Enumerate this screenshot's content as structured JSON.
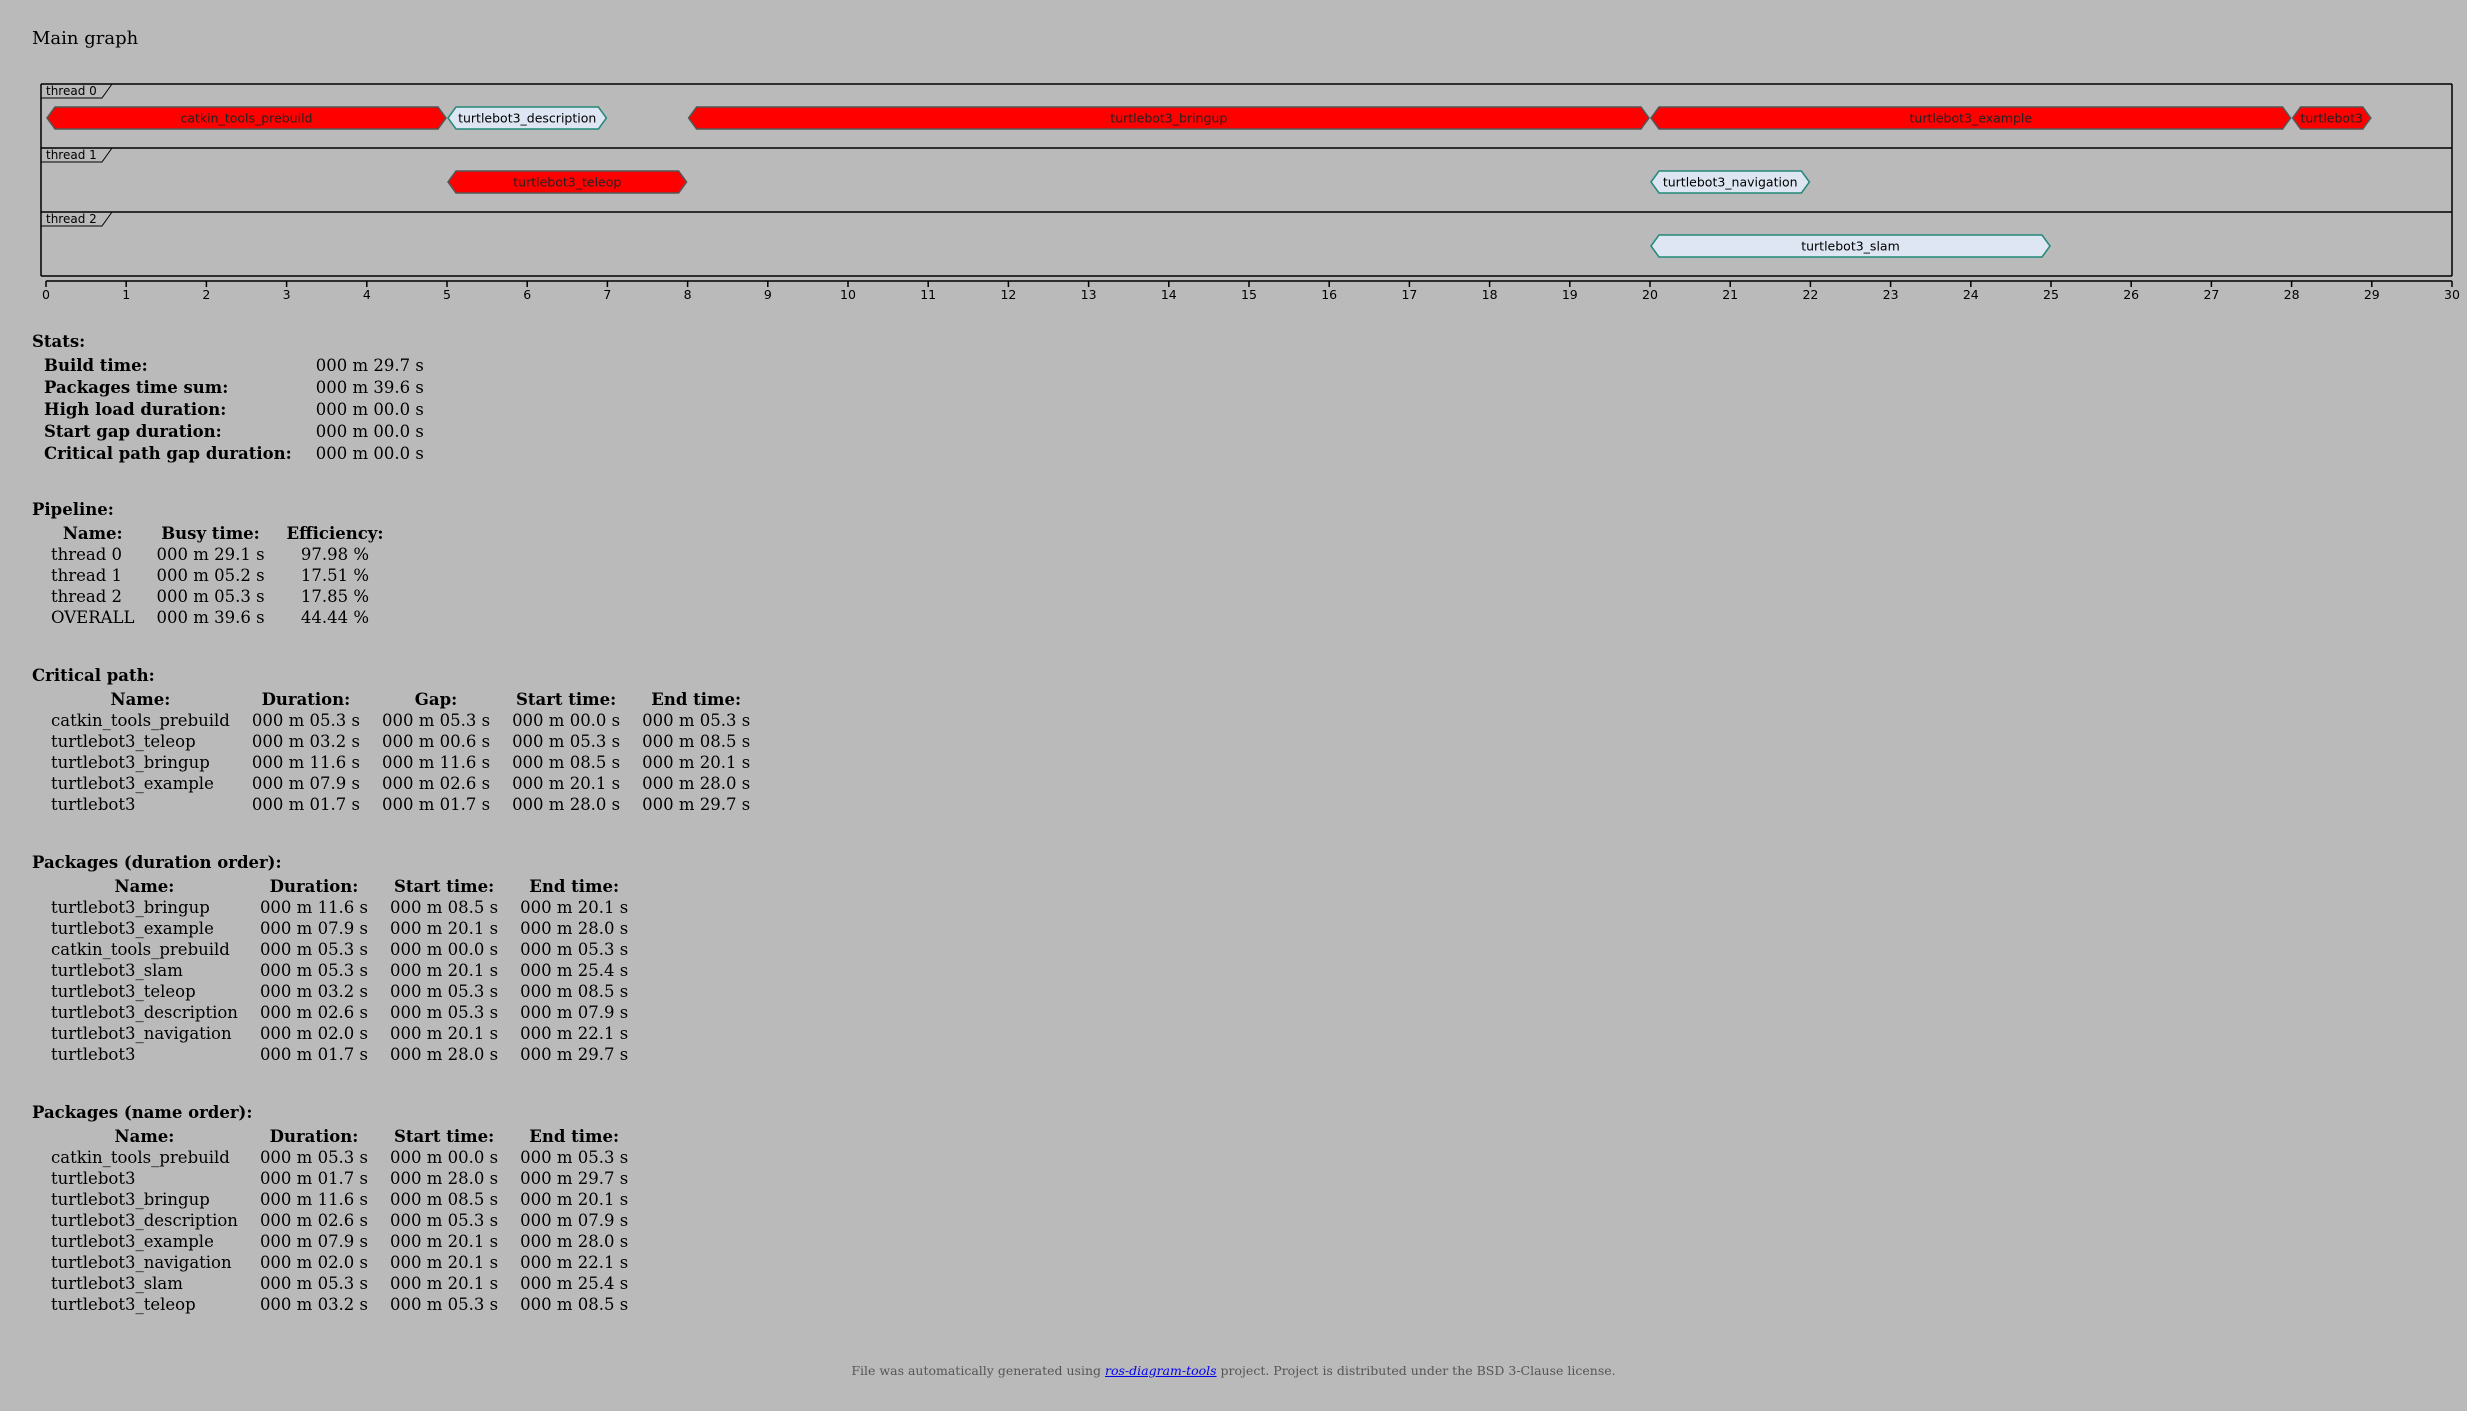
{
  "page": {
    "title": "Main graph"
  },
  "chart_data": {
    "type": "gantt",
    "x_range": [
      0,
      30
    ],
    "x_ticks": [
      0,
      1,
      2,
      3,
      4,
      5,
      6,
      7,
      8,
      9,
      10,
      11,
      12,
      13,
      14,
      15,
      16,
      17,
      18,
      19,
      20,
      21,
      22,
      23,
      24,
      25,
      26,
      27,
      28,
      29,
      30
    ],
    "threads": [
      {
        "label": "thread 0",
        "tasks": [
          {
            "name": "catkin_tools_prebuild",
            "start": 0.0,
            "end": 5.0,
            "critical": true
          },
          {
            "name": "turtlebot3_description",
            "start": 5.0,
            "end": 7.0,
            "critical": false
          },
          {
            "name": "turtlebot3_bringup",
            "start": 8.0,
            "end": 20.0,
            "critical": true
          },
          {
            "name": "turtlebot3_example",
            "start": 20.0,
            "end": 28.0,
            "critical": true
          },
          {
            "name": "turtlebot3",
            "start": 28.0,
            "end": 29.0,
            "critical": true
          }
        ]
      },
      {
        "label": "thread 1",
        "tasks": [
          {
            "name": "turtlebot3_teleop",
            "start": 5.0,
            "end": 8.0,
            "critical": true
          },
          {
            "name": "turtlebot3_navigation",
            "start": 20.0,
            "end": 22.0,
            "critical": false
          }
        ]
      },
      {
        "label": "thread 2",
        "tasks": [
          {
            "name": "turtlebot3_slam",
            "start": 20.0,
            "end": 25.0,
            "critical": false
          }
        ]
      }
    ],
    "colors": {
      "critical": "#ff0000",
      "normal": "#dde6f2",
      "critical_stroke": "#555555",
      "normal_stroke": "#228877"
    }
  },
  "stats": {
    "title": "Stats:",
    "rows": [
      {
        "key": "Build time:",
        "value": "000 m 29.7 s"
      },
      {
        "key": "Packages time sum:",
        "value": "000 m 39.6 s"
      },
      {
        "key": "High load duration:",
        "value": "000 m 00.0 s"
      },
      {
        "key": "Start gap duration:",
        "value": "000 m 00.0 s"
      },
      {
        "key": "Critical path gap duration:",
        "value": "000 m 00.0 s"
      }
    ]
  },
  "pipeline": {
    "title": "Pipeline:",
    "headers": [
      "Name:",
      "Busy time:",
      "Efficiency:"
    ],
    "rows": [
      [
        "thread 0",
        "000 m 29.1 s",
        "97.98 %"
      ],
      [
        "thread 1",
        "000 m 05.2 s",
        "17.51 %"
      ],
      [
        "thread 2",
        "000 m 05.3 s",
        "17.85 %"
      ],
      [
        "OVERALL",
        "000 m 39.6 s",
        "44.44 %"
      ]
    ]
  },
  "critical_path": {
    "title": "Critical path:",
    "headers": [
      "Name:",
      "Duration:",
      "Gap:",
      "Start time:",
      "End time:"
    ],
    "rows": [
      [
        "catkin_tools_prebuild",
        "000 m 05.3 s",
        "000 m 05.3 s",
        "000 m 00.0 s",
        "000 m 05.3 s"
      ],
      [
        "turtlebot3_teleop",
        "000 m 03.2 s",
        "000 m 00.6 s",
        "000 m 05.3 s",
        "000 m 08.5 s"
      ],
      [
        "turtlebot3_bringup",
        "000 m 11.6 s",
        "000 m 11.6 s",
        "000 m 08.5 s",
        "000 m 20.1 s"
      ],
      [
        "turtlebot3_example",
        "000 m 07.9 s",
        "000 m 02.6 s",
        "000 m 20.1 s",
        "000 m 28.0 s"
      ],
      [
        "turtlebot3",
        "000 m 01.7 s",
        "000 m 01.7 s",
        "000 m 28.0 s",
        "000 m 29.7 s"
      ]
    ]
  },
  "packages_duration": {
    "title": "Packages (duration order):",
    "headers": [
      "Name:",
      "Duration:",
      "Start time:",
      "End time:"
    ],
    "rows": [
      [
        "turtlebot3_bringup",
        "000 m 11.6 s",
        "000 m 08.5 s",
        "000 m 20.1 s"
      ],
      [
        "turtlebot3_example",
        "000 m 07.9 s",
        "000 m 20.1 s",
        "000 m 28.0 s"
      ],
      [
        "catkin_tools_prebuild",
        "000 m 05.3 s",
        "000 m 00.0 s",
        "000 m 05.3 s"
      ],
      [
        "turtlebot3_slam",
        "000 m 05.3 s",
        "000 m 20.1 s",
        "000 m 25.4 s"
      ],
      [
        "turtlebot3_teleop",
        "000 m 03.2 s",
        "000 m 05.3 s",
        "000 m 08.5 s"
      ],
      [
        "turtlebot3_description",
        "000 m 02.6 s",
        "000 m 05.3 s",
        "000 m 07.9 s"
      ],
      [
        "turtlebot3_navigation",
        "000 m 02.0 s",
        "000 m 20.1 s",
        "000 m 22.1 s"
      ],
      [
        "turtlebot3",
        "000 m 01.7 s",
        "000 m 28.0 s",
        "000 m 29.7 s"
      ]
    ]
  },
  "packages_name": {
    "title": "Packages (name order):",
    "headers": [
      "Name:",
      "Duration:",
      "Start time:",
      "End time:"
    ],
    "rows": [
      [
        "catkin_tools_prebuild",
        "000 m 05.3 s",
        "000 m 00.0 s",
        "000 m 05.3 s"
      ],
      [
        "turtlebot3",
        "000 m 01.7 s",
        "000 m 28.0 s",
        "000 m 29.7 s"
      ],
      [
        "turtlebot3_bringup",
        "000 m 11.6 s",
        "000 m 08.5 s",
        "000 m 20.1 s"
      ],
      [
        "turtlebot3_description",
        "000 m 02.6 s",
        "000 m 05.3 s",
        "000 m 07.9 s"
      ],
      [
        "turtlebot3_example",
        "000 m 07.9 s",
        "000 m 20.1 s",
        "000 m 28.0 s"
      ],
      [
        "turtlebot3_navigation",
        "000 m 02.0 s",
        "000 m 20.1 s",
        "000 m 22.1 s"
      ],
      [
        "turtlebot3_slam",
        "000 m 05.3 s",
        "000 m 20.1 s",
        "000 m 25.4 s"
      ],
      [
        "turtlebot3_teleop",
        "000 m 03.2 s",
        "000 m 05.3 s",
        "000 m 08.5 s"
      ]
    ]
  },
  "footer": {
    "prefix": "File was automatically generated using ",
    "link_text": "ros-diagram-tools",
    "suffix": " project. Project is distributed under the BSD 3-Clause license."
  }
}
